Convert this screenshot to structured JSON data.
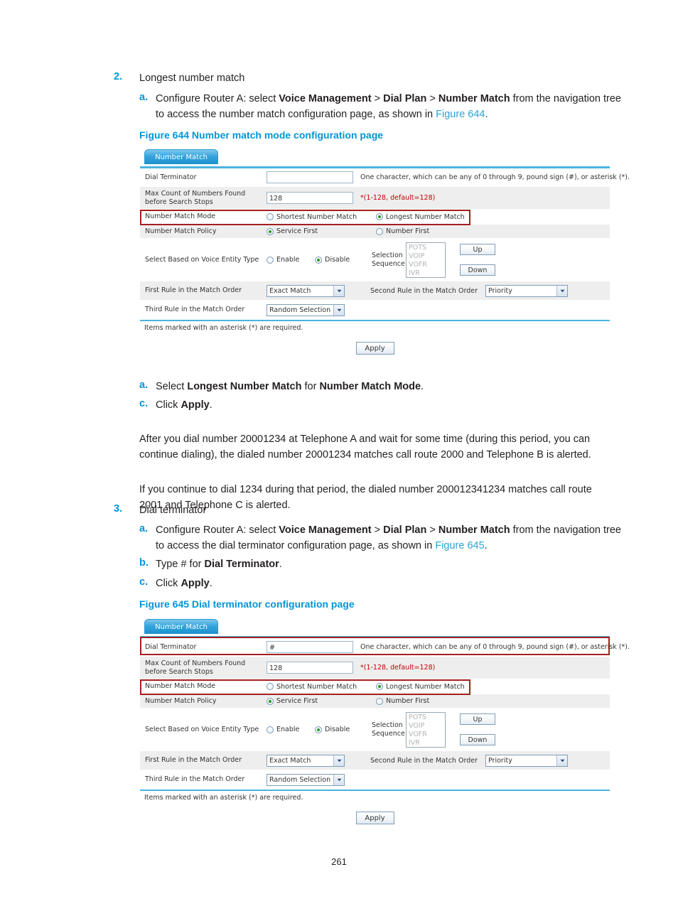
{
  "page": {
    "number": "261"
  },
  "steps": [
    {
      "num": "2.",
      "title": "Longest number match",
      "sub_a_label": "a.",
      "sub_a_pre": "Configure Router A: select ",
      "sub_a_b1": "Voice Management",
      "sub_a_sep1": " > ",
      "sub_a_b2": "Dial Plan",
      "sub_a_sep2": " > ",
      "sub_a_b3": "Number Match",
      "sub_a_post": " from the navigation tree to access the number match configuration page, as shown in ",
      "sub_a_xref": "Figure 644",
      "sub_a_end": "."
    }
  ],
  "figure644": {
    "caption": "Figure 644 Number match mode configuration page"
  },
  "step2b": {
    "label": "a.",
    "pre": "Select ",
    "b1": "Longest Number Match",
    "mid": " for ",
    "b2": "Number Match Mode",
    "end": "."
  },
  "step2c": {
    "label": "c.",
    "pre": "Click ",
    "b1": "Apply",
    "end": "."
  },
  "para1": "After you dial number 20001234 at Telephone A and wait for some time (during this period, you can continue dialing), the dialed number 20001234 matches call route 2000 and Telephone B is alerted.",
  "para2": "If you continue to dial 1234 during that period, the dialed number 200012341234 matches call route 2001 and Telephone C is alerted.",
  "step3": {
    "num": "3.",
    "title": "Dial terminator",
    "a_label": "a.",
    "a_pre": "Configure Router A: select ",
    "a_b1": "Voice Management",
    "a_sep1": " > ",
    "a_b2": "Dial Plan",
    "a_sep2": " > ",
    "a_b3": "Number Match",
    "a_post": " from the navigation tree to access the dial terminator configuration page, as shown in ",
    "a_xref": "Figure 645",
    "a_end": ".",
    "b_label": "b.",
    "b_pre": "Type # for ",
    "b_b1": "Dial Terminator",
    "b_end": ".",
    "c_label": "c.",
    "c_pre": "Click ",
    "c_b1": "Apply",
    "c_end": "."
  },
  "figure645": {
    "caption": "Figure 645 Dial terminator configuration page"
  },
  "ui": {
    "tab_label": "Number Match",
    "labels": {
      "dial_terminator": "Dial Terminator",
      "max_count": "Max Count of Numbers Found before Search Stops",
      "number_match_mode": "Number Match Mode",
      "number_match_policy": "Number Match Policy",
      "select_based_on_voice_entity": "Select Based on Voice Entity Type",
      "selection_sequence": "Selection Sequence",
      "first_rule": "First Rule in the Match Order",
      "second_rule": "Second Rule in the Match Order",
      "third_rule": "Third Rule in the Match Order"
    },
    "hints": {
      "dial_terminator": "One character, which can be any of 0 through 9, pound sign (#), or asterisk (*).",
      "max_count": "*(1-128, default=128)"
    },
    "options": {
      "shortest": "Shortest Number Match",
      "longest": "Longest Number Match",
      "service_first": "Service First",
      "number_first": "Number First",
      "enable": "Enable",
      "disable": "Disable"
    },
    "sequence_items": [
      "POTS",
      "VOIP",
      "VOFR",
      "IVR"
    ],
    "buttons": {
      "up": "Up",
      "down": "Down",
      "apply": "Apply"
    },
    "selects": {
      "first_rule_value": "Exact Match",
      "second_rule_value": "Priority",
      "third_rule_value": "Random Selection"
    },
    "footer_note": "Items marked with an asterisk (*) are required.",
    "values": {
      "dial_terminator_fig644": "",
      "dial_terminator_fig645": "#",
      "max_count": "128"
    }
  }
}
